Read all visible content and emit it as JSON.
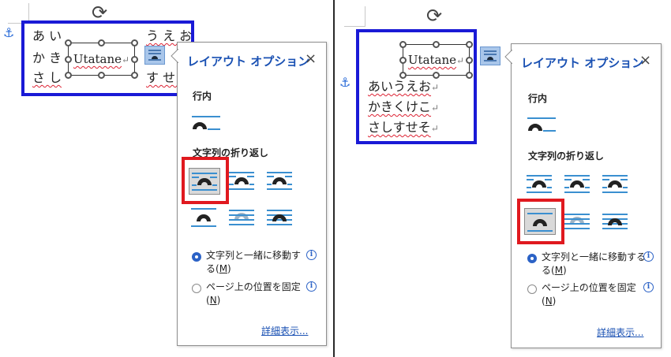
{
  "left": {
    "doc": {
      "rows": [
        {
          "lead": "あ い",
          "trail": "う え お"
        },
        {
          "lead": "か き",
          "trail": ""
        },
        {
          "lead": "さ し",
          "trail": "す せ そ"
        }
      ],
      "paragraph_mark": "↵"
    },
    "textbox_text": "Utatane",
    "panel": {
      "title": "レイアウト オプション",
      "close": "×",
      "inline_section": "行内",
      "wrap_section": "文字列の折り返し",
      "radio_move_a": "文字列と一緒に移動す",
      "radio_move_b": "る(",
      "radio_move_key": "M",
      "radio_move_c": ")",
      "radio_fix_a": "ページ上の位置を固定",
      "radio_fix_b": "(",
      "radio_fix_key": "N",
      "radio_fix_c": ")",
      "more": "詳細表示..."
    }
  },
  "right": {
    "doc": {
      "rows": [
        "あいうえお",
        "かきくけこ",
        "さしすせそ"
      ],
      "paragraph_mark": "↵"
    },
    "textbox_text": "Utatane",
    "panel": {
      "title": "レイアウト オプション",
      "close": "×",
      "inline_section": "行内",
      "wrap_section": "文字列の折り返し",
      "radio_move_a": "文字列と一緒に移動する",
      "radio_move_b": "る(",
      "radio_move_key": "M",
      "radio_move_c": ")",
      "radio_fix_a": "ページ上の位置を固定",
      "radio_fix_b": "(",
      "radio_fix_key": "N",
      "radio_fix_c": ")",
      "more": "詳細表示..."
    }
  },
  "icons": {
    "rotate": "rotate-handle-icon",
    "anchor": "anchor-icon",
    "layout": "layout-options-icon",
    "info": "info-icon"
  },
  "colors": {
    "highlight_blue": "#1a1ad6",
    "highlight_red": "#e0191f",
    "accent": "#2b62c6",
    "wrap_icon_blue": "#3a8fd0"
  }
}
